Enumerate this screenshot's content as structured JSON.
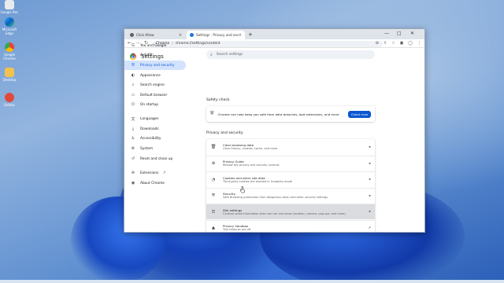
{
  "desktop": {
    "icons": [
      {
        "label": "Google Rec"
      },
      {
        "label": "Microsoft Edge"
      },
      {
        "label": "Google Chrome"
      },
      {
        "label": "Desktop"
      },
      {
        "label": "Roblox"
      }
    ]
  },
  "browser": {
    "tabs": [
      {
        "title": "Click Allow",
        "close": "×"
      },
      {
        "title": "Settings - Privacy and security",
        "close": "×"
      }
    ],
    "new_tab": "+",
    "window_controls": {
      "minimize": "—",
      "maximize": "□",
      "close": "✕"
    },
    "nav": {
      "back": "←",
      "forward": "→",
      "reload": "↻"
    },
    "address": {
      "site_label": "Chrome",
      "separator": "|",
      "url": "chrome://settings/content"
    },
    "toolbar_icons": [
      "zoom-icon",
      "share-icon",
      "star-icon",
      "extensions-icon",
      "profile-icon",
      "menu-icon"
    ]
  },
  "settings": {
    "title": "Settings",
    "search_placeholder": "Search settings",
    "sidebar": [
      {
        "label": "You and Google",
        "icon": "G"
      },
      {
        "label": "Autofill",
        "icon": "▤"
      },
      {
        "label": "Privacy and security",
        "icon": "⛨",
        "active": true
      },
      {
        "label": "Appearance",
        "icon": "◐"
      },
      {
        "label": "Search engine",
        "icon": "⌕"
      },
      {
        "label": "Default browser",
        "icon": "▭"
      },
      {
        "label": "On startup",
        "icon": "⏻"
      },
      {
        "label": "Languages",
        "icon": "文"
      },
      {
        "label": "Downloads",
        "icon": "⤓"
      },
      {
        "label": "Accessibility",
        "icon": "♿"
      },
      {
        "label": "System",
        "icon": "⚙"
      },
      {
        "label": "Reset and clean up",
        "icon": "↺"
      },
      {
        "label": "Extensions",
        "icon": "✣",
        "external": "↗"
      },
      {
        "label": "About Chrome",
        "icon": "◉"
      }
    ],
    "safety_check": {
      "heading": "Safety check",
      "text": "Chrome can help keep you safe from data breaches, bad extensions, and more",
      "button": "Check now"
    },
    "privacy": {
      "heading": "Privacy and security",
      "rows": [
        {
          "title": "Clear browsing data",
          "subtitle": "Clear history, cookies, cache, and more",
          "icon": "🗑",
          "arrow": "▸"
        },
        {
          "title": "Privacy Guide",
          "subtitle": "Review key privacy and security controls",
          "icon": "⊕",
          "arrow": "▸"
        },
        {
          "title": "Cookies and other site data",
          "subtitle": "Third-party cookies are blocked in Incognito mode",
          "icon": "◔",
          "arrow": "▸"
        },
        {
          "title": "Security",
          "subtitle": "Safe Browsing (protection from dangerous sites) and other security settings",
          "icon": "⛨",
          "arrow": "▸"
        },
        {
          "title": "Site settings",
          "subtitle": "Controls what information sites can use and show (location, camera, pop-ups, and more)",
          "icon": "☰",
          "arrow": "▸",
          "hover": true
        },
        {
          "title": "Privacy Sandbox",
          "subtitle": "Trial features are off",
          "icon": "▲",
          "arrow": "↗"
        }
      ]
    }
  }
}
